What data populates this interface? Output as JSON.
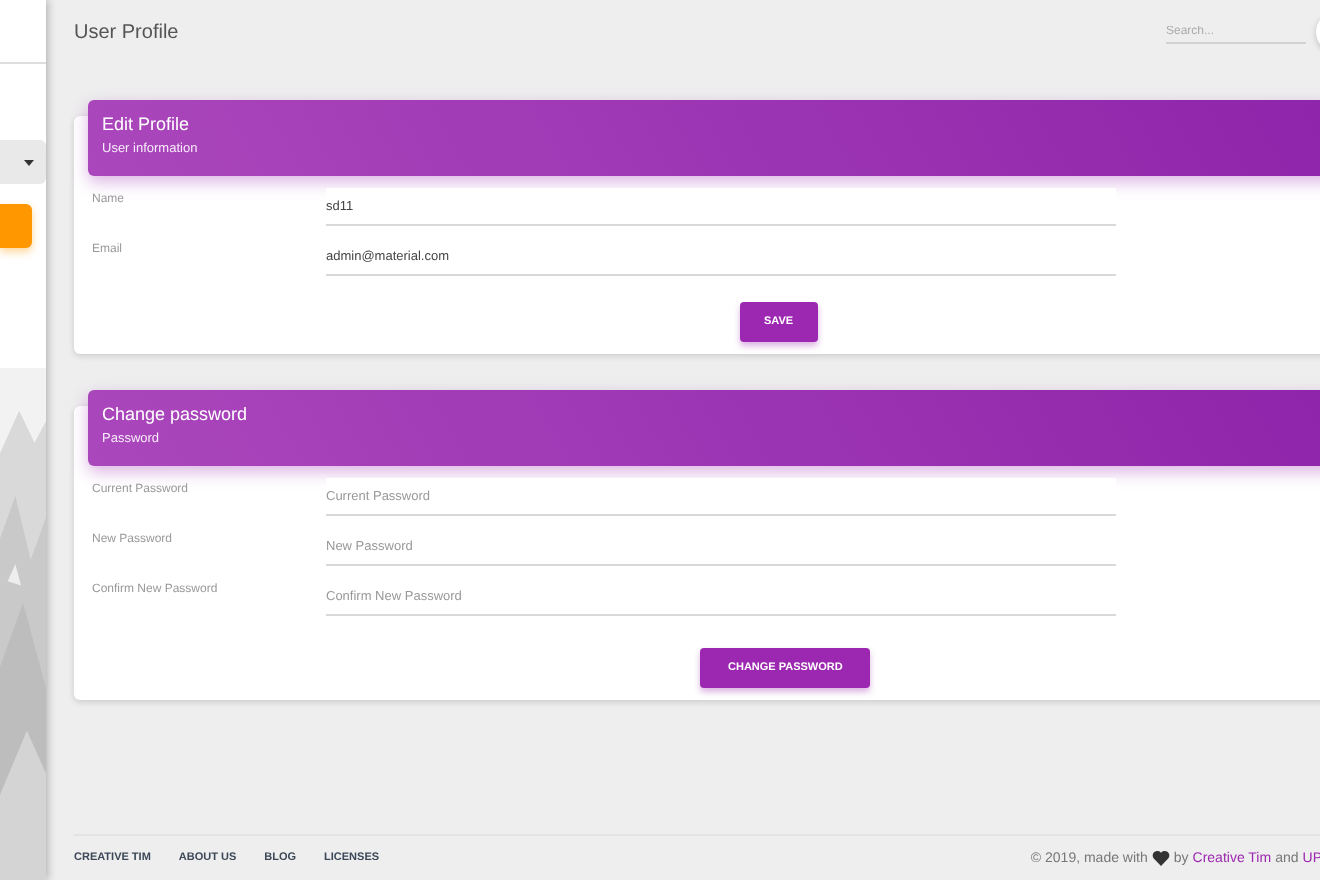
{
  "sidebar": {
    "items": [
      {
        "expandable": true,
        "selected": false
      },
      {
        "expandable": false,
        "selected": true
      }
    ]
  },
  "navbar": {
    "title": "User Profile",
    "search": {
      "placeholder": "Search..."
    }
  },
  "cards": [
    {
      "title": "Edit Profile",
      "subtitle": "User information",
      "fields": [
        {
          "label": "Name",
          "value": "sd11"
        },
        {
          "label": "Email",
          "value": "admin@material.com"
        }
      ],
      "button": "SAVE"
    },
    {
      "title": "Change password",
      "subtitle": "Password",
      "fields": [
        {
          "label": "Current Password",
          "placeholder": "Current Password"
        },
        {
          "label": "New Password",
          "placeholder": "New Password"
        },
        {
          "label": "Confirm New Password",
          "placeholder": "Confirm New Password"
        }
      ],
      "button": "CHANGE PASSWORD"
    }
  ],
  "footer": {
    "links": [
      "CREATIVE TIM",
      "ABOUT US",
      "BLOG",
      "LICENSES"
    ],
    "credit": {
      "before": "© 2019, made with",
      "by": "by",
      "authors": [
        "Creative Tim",
        "UP"
      ],
      "joiner": "and"
    }
  }
}
